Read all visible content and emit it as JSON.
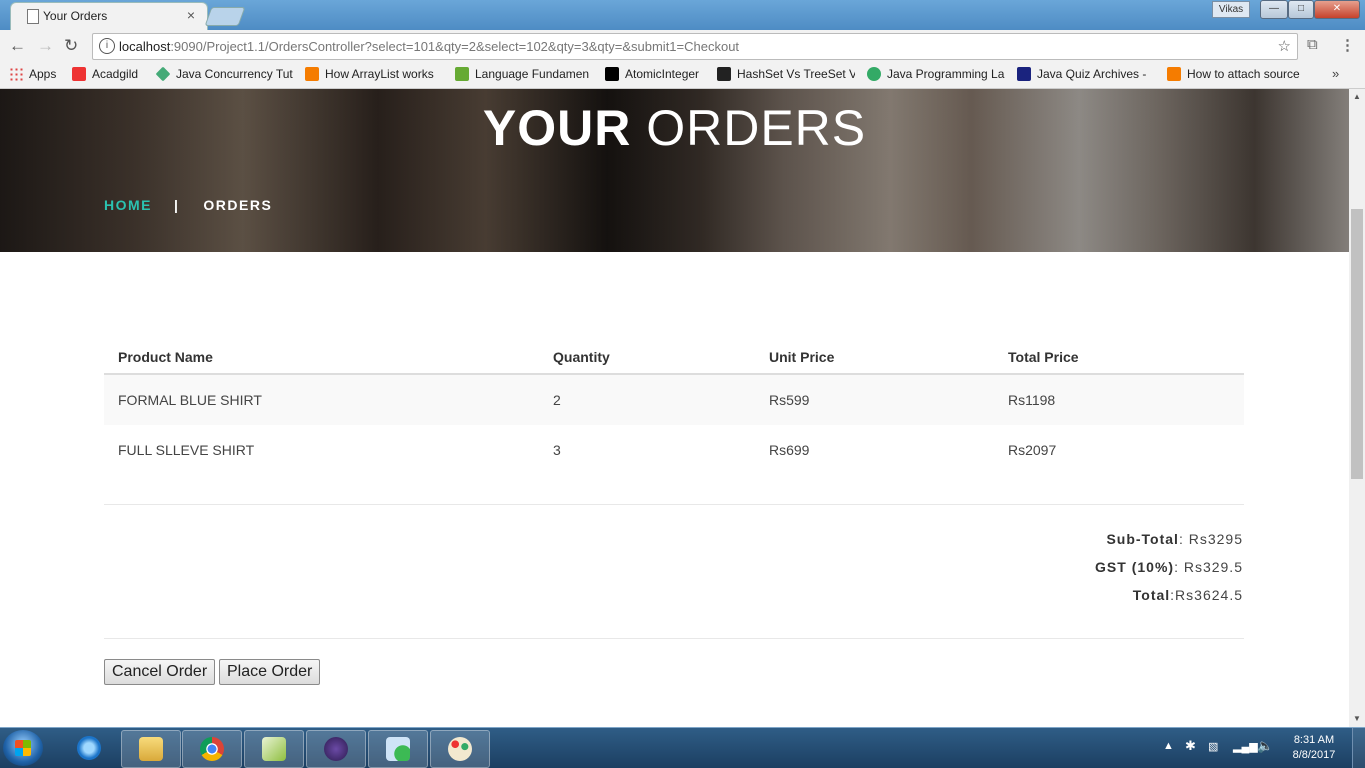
{
  "browser": {
    "tab_title": "Your Orders",
    "tab_close": "×",
    "user_name": "Vikas",
    "url_host": "localhost",
    "url_path": ":9090/Project1.1/OrdersController?select=101&qty=2&select=102&qty=3&qty=&submit1=Checkout",
    "bookmarks": [
      {
        "label": "Apps",
        "color": "#d44"
      },
      {
        "label": "Acadgild",
        "color": "#e33"
      },
      {
        "label": "Java Concurrency Tut",
        "color": "#4a7"
      },
      {
        "label": "How ArrayList works",
        "color": "#f57c00"
      },
      {
        "label": "Language Fundamen",
        "color": "#6a3"
      },
      {
        "label": "AtomicInteger",
        "color": "#000"
      },
      {
        "label": "HashSet Vs TreeSet V",
        "color": "#222"
      },
      {
        "label": "Java Programming La",
        "color": "#3a6"
      },
      {
        "label": "Java Quiz Archives -",
        "color": "#1a237e"
      },
      {
        "label": "How to attach source",
        "color": "#f57c00"
      }
    ],
    "more": "»"
  },
  "page": {
    "hero_bold": "YOUR",
    "hero_normal": "ORDERS",
    "breadcrumb_home": "HOME",
    "breadcrumb_sep": "|",
    "breadcrumb_current": "ORDERS",
    "table": {
      "headers": [
        "Product Name",
        "Quantity",
        "Unit Price",
        "Total Price"
      ],
      "rows": [
        [
          "FORMAL BLUE SHIRT",
          "2",
          "Rs599",
          "Rs1198"
        ],
        [
          "FULL SLLEVE SHIRT",
          "3",
          "Rs699",
          "Rs2097"
        ]
      ]
    },
    "subtotal_label": "Sub-Total",
    "subtotal_value": ": Rs3295",
    "gst_label": "GST (10%)",
    "gst_value": ": Rs329.5",
    "total_label": "Total",
    "total_value": ":Rs3624.5",
    "cancel_button": "Cancel Order",
    "place_button": "Place Order"
  },
  "taskbar": {
    "time": "8:31 AM",
    "date": "8/8/2017"
  }
}
